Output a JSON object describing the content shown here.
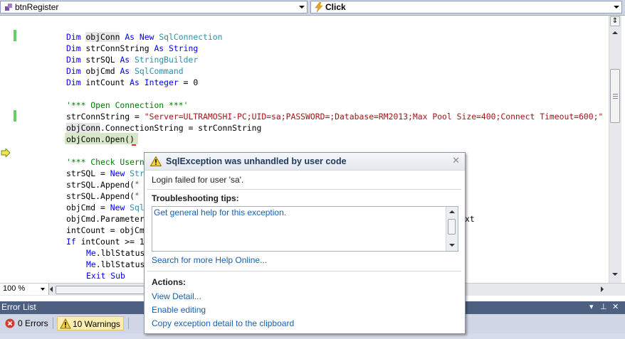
{
  "navbar": {
    "class_combo": "btnRegister",
    "method_combo": "Click"
  },
  "code_lines": [
    "    Dim objConn As New SqlConnection",
    "    Dim strConnString As String",
    "    Dim strSQL As StringBuilder",
    "    Dim objCmd As SqlCommand",
    "    Dim intCount As Integer = 0",
    "",
    "    '*** Open Connection ***'",
    "    strConnString = \"Server=ULTRAMOSHI-PC;UID=sa;PASSWORD=;Database=RM2013;Max Pool Size=400;Connect Timeout=600;\"",
    "    objConn.ConnectionString = strConnString",
    "    objConn.Open()",
    "",
    "    '*** Check Userna",
    "    strSQL = New Str",
    "    strSQL.Append(\" ",
    "    strSQL.Append(\" ",
    "    objCmd = New Sql",
    "    objCmd.Parameter",
    "    intCount = objCm",
    "    If intCount >= 1",
    "        Me.lblStatus",
    "        Me.lblStatus",
    "        Exit Sub"
  ],
  "code_tail": {
    "line16": "xt"
  },
  "zoom": "100 %",
  "error_list": {
    "title": "Error List",
    "errors_label": "0 Errors",
    "warnings_label": "10 Warnings"
  },
  "exception": {
    "title": "SqlException was unhandled by user code",
    "message": "Login failed for user 'sa'.",
    "tips_header": "Troubleshooting tips:",
    "tip_link": "Get general help for this exception.",
    "search_link": "Search for more Help Online...",
    "actions_header": "Actions:",
    "actions": [
      "View Detail...",
      "Enable editing",
      "Copy exception detail to the clipboard"
    ]
  }
}
